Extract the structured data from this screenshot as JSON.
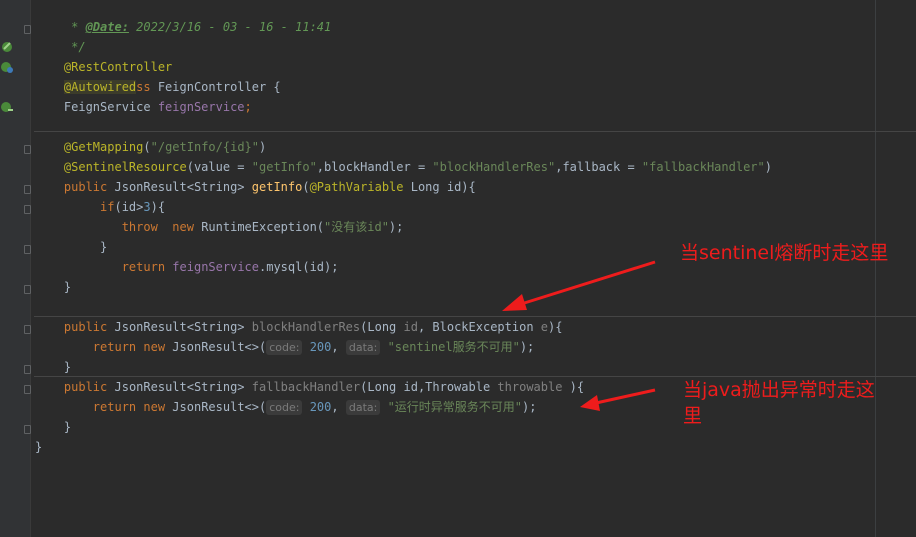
{
  "code": {
    "l1": {
      "star": " * ",
      "tag": "@Date:",
      "val": " 2022/3/16 - 03 - 16 - 11:41"
    },
    "l2": " */",
    "l3": "@RestController",
    "l4": {
      "kw": "public class",
      "name": " FeignController {"
    },
    "l5": "@Autowired",
    "l6": {
      "type": "FeignService ",
      "field": "feignService",
      "semi": ";"
    },
    "l7": {
      "ann": "@GetMapping",
      "open": "(",
      "str": "\"/getInfo/{id}\"",
      "close": ")"
    },
    "l8": {
      "ann": "@SentinelResource",
      "a": "(value = ",
      "s1": "\"getInfo\"",
      "b": ",blockHandler = ",
      "s2": "\"blockHandlerRes\"",
      "c": ",fallback = ",
      "s3": "\"fallbackHandler\"",
      "d": ")"
    },
    "l9": {
      "kw": "public",
      "a": " JsonResult<String> ",
      "fn": "getInfo",
      "b": "(",
      "ann": "@PathVariable",
      "c": " Long id){"
    },
    "l10": {
      "kw": "if",
      "a": "(id>",
      "num": "3",
      "b": "){"
    },
    "l11": {
      "kw1": "throw",
      "sp": "  ",
      "kw2": "new",
      "a": " RuntimeException(",
      "str": "\"没有该id\"",
      "b": ");"
    },
    "l12": "}",
    "l13": {
      "kw": "return",
      "sp": " ",
      "fld": "feignService",
      "a": ".mysql(id);"
    },
    "l14": "}",
    "l15": {
      "kw": "public",
      "a": " JsonResult<String> ",
      "fn": "blockHandlerRes",
      "b": "(Long ",
      "p1": "id",
      "c": ", BlockException ",
      "p2": "e",
      "d": "){"
    },
    "l16": {
      "kw1": "return",
      "sp": " ",
      "kw2": "new",
      "a": " JsonResult<>(",
      "h1": "code:",
      "n": "200",
      "b": ", ",
      "h2": "data:",
      "str": "\"sentinel服务不可用\"",
      "c": ");"
    },
    "l17": "}",
    "l18": {
      "kw": "public",
      "a": " JsonResult<String> ",
      "fn": "fallbackHandler",
      "b": "(Long id,Throwable ",
      "p": "throwable",
      "c": " ){"
    },
    "l19": {
      "kw1": "return",
      "sp": " ",
      "kw2": "new",
      "a": " JsonResult<>(",
      "h1": "code:",
      "n": "200",
      "b": ", ",
      "h2": "data:",
      "str": "\"运行时异常服务不可用\"",
      "c": ");"
    },
    "l20": "}",
    "l21": "}"
  },
  "annotations": {
    "sentinel_note": "当sentinel熔断时走这里",
    "java_note_line1": "当java抛出异常时走这",
    "java_note_line2": "里"
  },
  "icons": [
    "spring-bean-icon",
    "spring-controller-icon",
    "spring-autowired-icon"
  ],
  "colors": {
    "keyword": "#cc7832",
    "string": "#6a8759",
    "annotation": "#bbb529",
    "field": "#9876aa",
    "method": "#ffc66d",
    "number": "#6897bb",
    "note": "#ee1c1c"
  }
}
